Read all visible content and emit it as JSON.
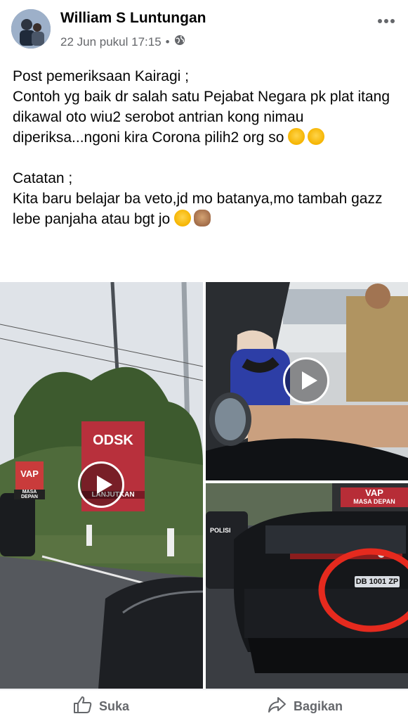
{
  "post": {
    "author": "William S Luntungan",
    "timestamp": "22 Jun pukul 17:15",
    "separator": "•",
    "privacy_icon": "globe-icon",
    "more_icon": "more-options-icon"
  },
  "body": {
    "line1": "Post pemeriksaan Kairagi ;",
    "line2": "Contoh yg baik dr salah satu Pejabat Negara pk plat itang dikawal oto wiu2 serobot antrian kong nimau diperiksa...ngoni kira Corona pilih2 org so",
    "line3": "Catatan ;",
    "line4": "Kita baru belajar ba veto,jd mo batanya,mo tambah gazz lebe panjaha atau bgt jo"
  },
  "media": {
    "billboard_text": "ODSK",
    "billboard_sub": "LANJUTKAN",
    "sign1": "VAP",
    "sign2": "MASA DEPAN",
    "sign3": "VAP",
    "sign4": "MASA DEPAN",
    "plate_text": "DB 1001 ZP",
    "police_text": "POLISI",
    "play_icon": "play-icon"
  },
  "actions": {
    "like_label": "Suka",
    "share_label": "Bagikan"
  },
  "colors": {
    "meta_gray": "#65676b",
    "highlight_red": "#e52a1e"
  }
}
